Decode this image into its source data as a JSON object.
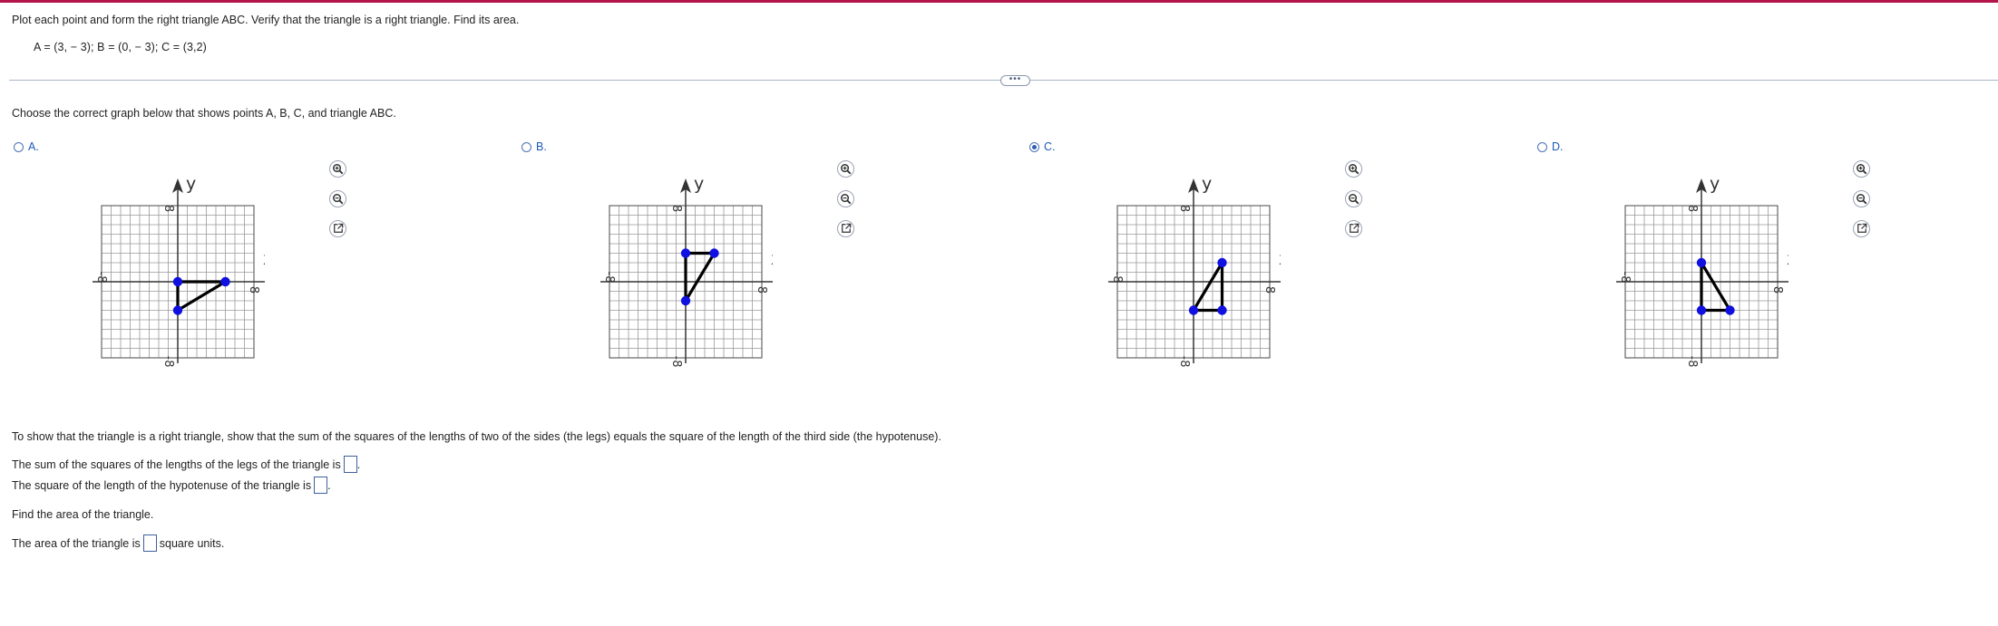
{
  "question": {
    "instruction": "Plot each point and form the right triangle ABC. Verify that the triangle is a right triangle. Find its area.",
    "points": "A = (3, − 3);   B = (0, − 3);   C = (3,2)"
  },
  "more_button": "•••",
  "choose_prompt": "Choose the correct graph below that shows points A, B, C, and triangle ABC.",
  "options": [
    {
      "letter": "A.",
      "selected": false,
      "triangle": [
        [
          0,
          -3
        ],
        [
          5,
          0
        ],
        [
          0,
          0
        ]
      ]
    },
    {
      "letter": "B.",
      "selected": false,
      "triangle": [
        [
          0,
          -2
        ],
        [
          3,
          3
        ],
        [
          0,
          3
        ]
      ]
    },
    {
      "letter": "C.",
      "selected": true,
      "triangle": [
        [
          0,
          -3
        ],
        [
          3,
          -3
        ],
        [
          3,
          2
        ]
      ]
    },
    {
      "letter": "D.",
      "selected": false,
      "triangle": [
        [
          3,
          -3
        ],
        [
          0,
          -3
        ],
        [
          0,
          2
        ]
      ]
    }
  ],
  "graph": {
    "range": [
      -8,
      8
    ],
    "x_axis_label": "x",
    "y_axis_label": "y",
    "tick_label_min": "-8",
    "tick_label_max": "8"
  },
  "tools": [
    "zoom-in-icon",
    "zoom-out-icon",
    "new-window-icon"
  ],
  "colors": {
    "top_bar": "#b3154a",
    "option_letter": "#1a5bb5",
    "point": "#1010e0",
    "triangle": "#000000",
    "grid": "#9a9a9a"
  },
  "explanation": "To show that the triangle is a right triangle, show that the sum of the squares of the lengths of two of the sides (the legs) equals the square of the length of the third side (the hypotenuse).",
  "sum_legs_label": "The sum of the squares of the lengths of the legs of the triangle is",
  "sum_legs_suffix": ".",
  "hyp_label": "The square of the length of the hypotenuse of the triangle is",
  "hyp_suffix": ".",
  "area_prompt": "Find the area of the triangle.",
  "area_label": "The area of the triangle is",
  "area_suffix": "square units."
}
